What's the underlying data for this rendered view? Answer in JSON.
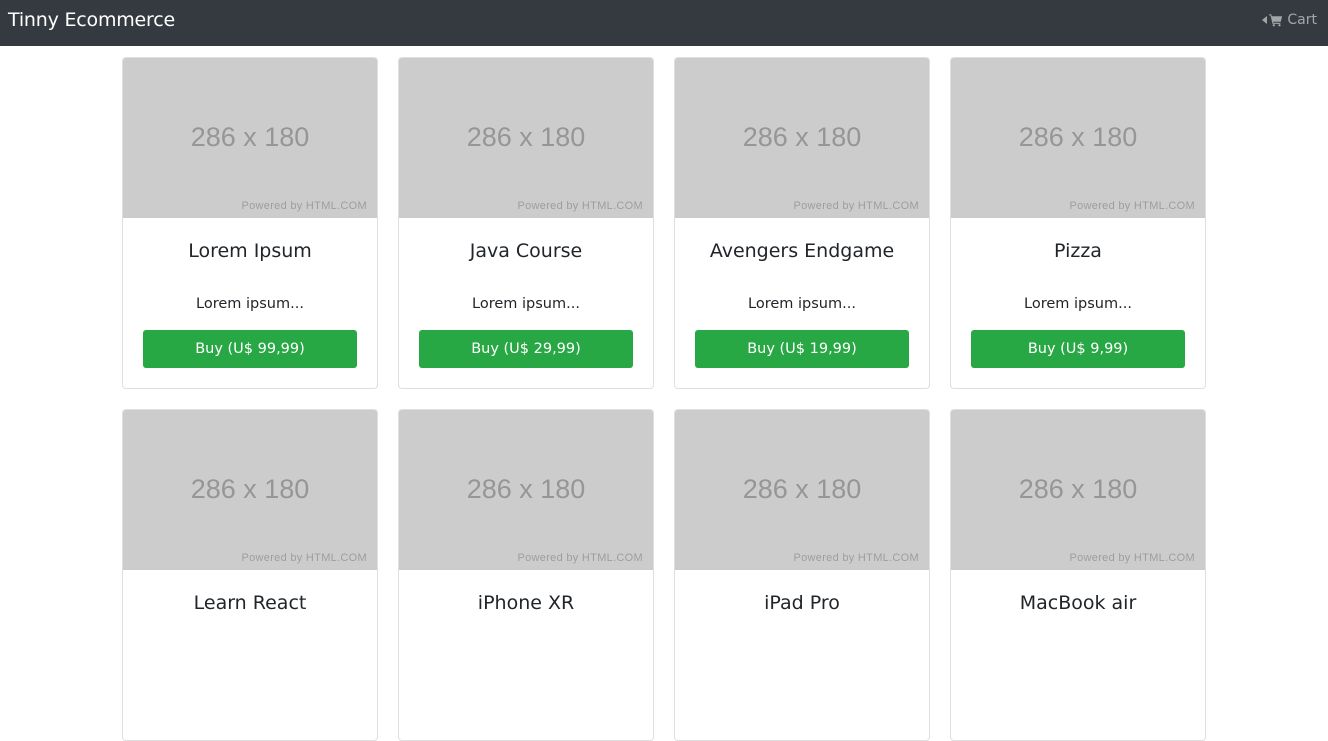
{
  "navbar": {
    "brand": "Tinny Ecommerce",
    "cart_label": "Cart",
    "cart_color": "#ffffff8c",
    "background": "#343a40"
  },
  "placeholder": {
    "dimensions": "286 x 180",
    "powered_by": "Powered by HTML.COM",
    "background": "#cccccc"
  },
  "products": [
    {
      "title": "Lorem Ipsum",
      "description": "Lorem ipsum...",
      "buy_label": "Buy (U$ 99,99)"
    },
    {
      "title": "Java Course",
      "description": "Lorem ipsum...",
      "buy_label": "Buy (U$ 29,99)"
    },
    {
      "title": "Avengers Endgame",
      "description": "Lorem ipsum...",
      "buy_label": "Buy (U$ 19,99)"
    },
    {
      "title": "Pizza",
      "description": "Lorem ipsum...",
      "buy_label": "Buy (U$ 9,99)"
    },
    {
      "title": "Learn React",
      "description": "",
      "buy_label": ""
    },
    {
      "title": "iPhone XR",
      "description": "",
      "buy_label": ""
    },
    {
      "title": "iPad Pro",
      "description": "",
      "buy_label": ""
    },
    {
      "title": "MacBook air",
      "description": "",
      "buy_label": ""
    }
  ],
  "colors": {
    "buy_button": "#28a745",
    "card_border": "#dfdfdf"
  },
  "icons": {
    "cart": "cart-icon",
    "caret": "caret-left-icon"
  }
}
